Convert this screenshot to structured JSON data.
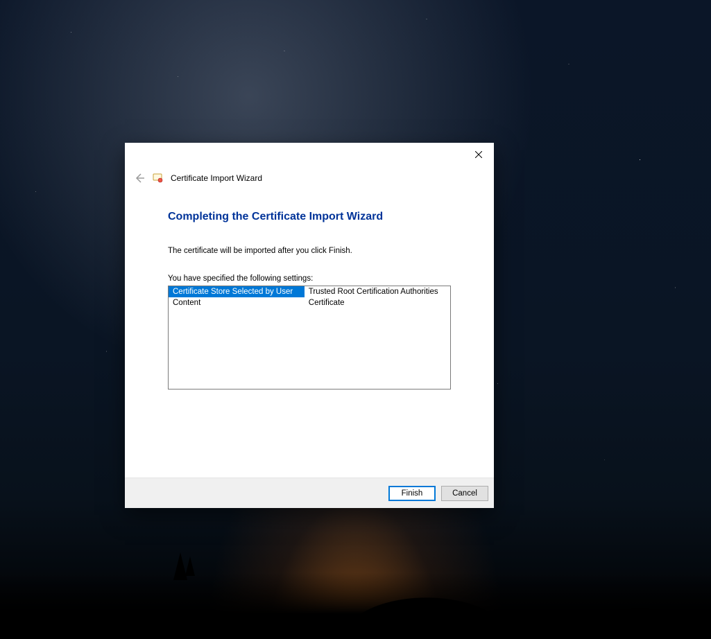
{
  "wizard": {
    "title_small": "Certificate Import Wizard",
    "heading": "Completing the Certificate Import Wizard",
    "body": "The certificate will be imported after you click Finish.",
    "settings_intro": "You have specified the following settings:",
    "settings": [
      {
        "key": "Certificate Store Selected by User",
        "value": "Trusted Root Certification Authorities",
        "selected": true
      },
      {
        "key": "Content",
        "value": "Certificate",
        "selected": false
      }
    ],
    "buttons": {
      "finish": "Finish",
      "cancel": "Cancel"
    }
  }
}
